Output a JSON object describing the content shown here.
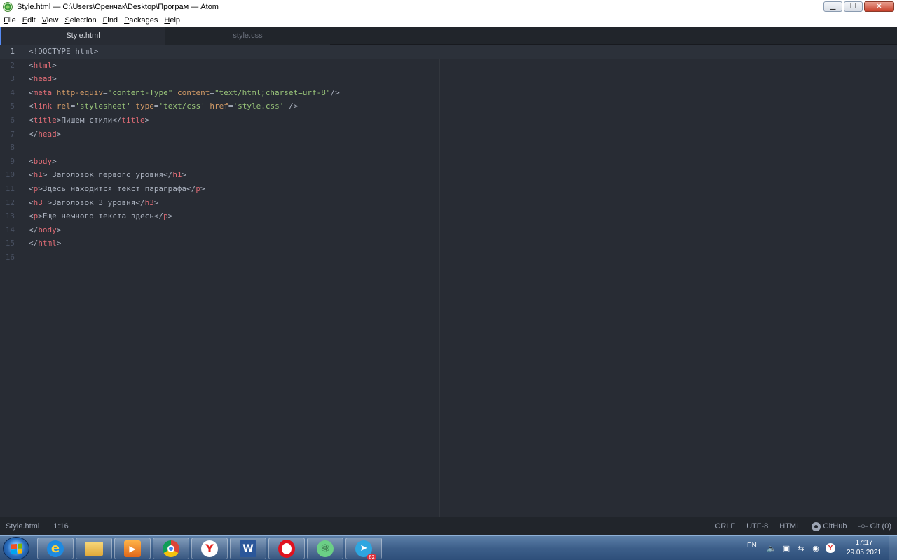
{
  "window": {
    "title": "Style.html — C:\\Users\\Оренчак\\Desktop\\Програм — Atom",
    "minimize_label": "▁",
    "maximize_label": "❐",
    "close_label": "✕"
  },
  "menu": [
    {
      "ul": "F",
      "rest": "ile"
    },
    {
      "ul": "E",
      "rest": "dit"
    },
    {
      "ul": "V",
      "rest": "iew"
    },
    {
      "ul": "S",
      "rest": "election"
    },
    {
      "ul": "F",
      "rest": "ind"
    },
    {
      "ul": "P",
      "rest": "ackages"
    },
    {
      "ul": "H",
      "rest": "elp"
    }
  ],
  "tabs": {
    "active": "Style.html",
    "inactive": "style.css"
  },
  "editor": {
    "cursor_line": 1,
    "lines": [
      {
        "n": "1",
        "tokens": [
          {
            "t": "plain",
            "v": "<!DOCTYPE html>"
          }
        ]
      },
      {
        "n": "2",
        "tokens": [
          {
            "t": "plain",
            "v": "<"
          },
          {
            "t": "tag",
            "v": "html"
          },
          {
            "t": "plain",
            "v": ">"
          }
        ]
      },
      {
        "n": "3",
        "tokens": [
          {
            "t": "plain",
            "v": "<"
          },
          {
            "t": "tag",
            "v": "head"
          },
          {
            "t": "plain",
            "v": ">"
          }
        ]
      },
      {
        "n": "4",
        "tokens": [
          {
            "t": "plain",
            "v": "<"
          },
          {
            "t": "tag",
            "v": "meta"
          },
          {
            "t": "plain",
            "v": " "
          },
          {
            "t": "attr",
            "v": "http-equiv"
          },
          {
            "t": "plain",
            "v": "="
          },
          {
            "t": "str",
            "v": "\"content-Type\""
          },
          {
            "t": "plain",
            "v": " "
          },
          {
            "t": "attr",
            "v": "content"
          },
          {
            "t": "plain",
            "v": "="
          },
          {
            "t": "str",
            "v": "\"text/html;charset=urf-8\""
          },
          {
            "t": "plain",
            "v": "/>"
          }
        ]
      },
      {
        "n": "5",
        "tokens": [
          {
            "t": "plain",
            "v": "<"
          },
          {
            "t": "tag",
            "v": "link"
          },
          {
            "t": "plain",
            "v": " "
          },
          {
            "t": "attr",
            "v": "rel"
          },
          {
            "t": "plain",
            "v": "="
          },
          {
            "t": "str",
            "v": "'stylesheet'"
          },
          {
            "t": "plain",
            "v": " "
          },
          {
            "t": "attr",
            "v": "type"
          },
          {
            "t": "plain",
            "v": "="
          },
          {
            "t": "str",
            "v": "'text/css'"
          },
          {
            "t": "plain",
            "v": " "
          },
          {
            "t": "attr",
            "v": "href"
          },
          {
            "t": "plain",
            "v": "="
          },
          {
            "t": "str",
            "v": "'style.css'"
          },
          {
            "t": "plain",
            "v": " />"
          }
        ]
      },
      {
        "n": "6",
        "tokens": [
          {
            "t": "plain",
            "v": "<"
          },
          {
            "t": "tag",
            "v": "title"
          },
          {
            "t": "plain",
            "v": ">Пишем стили</"
          },
          {
            "t": "tag",
            "v": "title"
          },
          {
            "t": "plain",
            "v": ">"
          }
        ]
      },
      {
        "n": "7",
        "tokens": [
          {
            "t": "plain",
            "v": "</"
          },
          {
            "t": "tag",
            "v": "head"
          },
          {
            "t": "plain",
            "v": ">"
          }
        ]
      },
      {
        "n": "8",
        "tokens": []
      },
      {
        "n": "9",
        "tokens": [
          {
            "t": "plain",
            "v": "<"
          },
          {
            "t": "tag",
            "v": "body"
          },
          {
            "t": "plain",
            "v": ">"
          }
        ]
      },
      {
        "n": "10",
        "tokens": [
          {
            "t": "plain",
            "v": "<"
          },
          {
            "t": "tag",
            "v": "h1"
          },
          {
            "t": "plain",
            "v": "> Заголовок первого уровня</"
          },
          {
            "t": "tag",
            "v": "h1"
          },
          {
            "t": "plain",
            "v": ">"
          }
        ]
      },
      {
        "n": "11",
        "tokens": [
          {
            "t": "plain",
            "v": "<"
          },
          {
            "t": "tag",
            "v": "p"
          },
          {
            "t": "plain",
            "v": ">Здесь находится текст параграфа</"
          },
          {
            "t": "tag",
            "v": "p"
          },
          {
            "t": "plain",
            "v": ">"
          }
        ]
      },
      {
        "n": "12",
        "tokens": [
          {
            "t": "plain",
            "v": "<"
          },
          {
            "t": "tag",
            "v": "h3"
          },
          {
            "t": "plain",
            "v": " >Заголовок 3 уровня</"
          },
          {
            "t": "tag",
            "v": "h3"
          },
          {
            "t": "plain",
            "v": ">"
          }
        ]
      },
      {
        "n": "13",
        "tokens": [
          {
            "t": "plain",
            "v": "<"
          },
          {
            "t": "tag",
            "v": "p"
          },
          {
            "t": "plain",
            "v": ">Еще немного текста здесь</"
          },
          {
            "t": "tag",
            "v": "p"
          },
          {
            "t": "plain",
            "v": ">"
          }
        ]
      },
      {
        "n": "14",
        "tokens": [
          {
            "t": "plain",
            "v": "</"
          },
          {
            "t": "tag",
            "v": "body"
          },
          {
            "t": "plain",
            "v": ">"
          }
        ]
      },
      {
        "n": "15",
        "tokens": [
          {
            "t": "plain",
            "v": "</"
          },
          {
            "t": "tag",
            "v": "html"
          },
          {
            "t": "plain",
            "v": ">"
          }
        ]
      },
      {
        "n": "16",
        "tokens": []
      }
    ]
  },
  "status": {
    "file": "Style.html",
    "cursor": "1:16",
    "line_ending": "CRLF",
    "encoding": "UTF-8",
    "grammar": "HTML",
    "github": "GitHub",
    "git": "Git (0)"
  },
  "taskbar": {
    "apps": [
      {
        "name": "internet-explorer",
        "glyph": "e"
      },
      {
        "name": "file-explorer",
        "glyph": ""
      },
      {
        "name": "media-player",
        "glyph": "▶"
      },
      {
        "name": "chrome",
        "glyph": ""
      },
      {
        "name": "yandex-browser",
        "glyph": "Y"
      },
      {
        "name": "word",
        "glyph": "W"
      },
      {
        "name": "opera",
        "glyph": ""
      },
      {
        "name": "atom",
        "glyph": "⚛"
      },
      {
        "name": "telegram",
        "glyph": "➤",
        "badge": "62"
      }
    ],
    "language": "EN",
    "time": "17:17",
    "date": "29.05.2021"
  },
  "colors": {
    "accent": "#568af2",
    "tag": "#e06c75",
    "attr": "#d19a66",
    "string": "#98c379",
    "text": "#abb2bf"
  }
}
